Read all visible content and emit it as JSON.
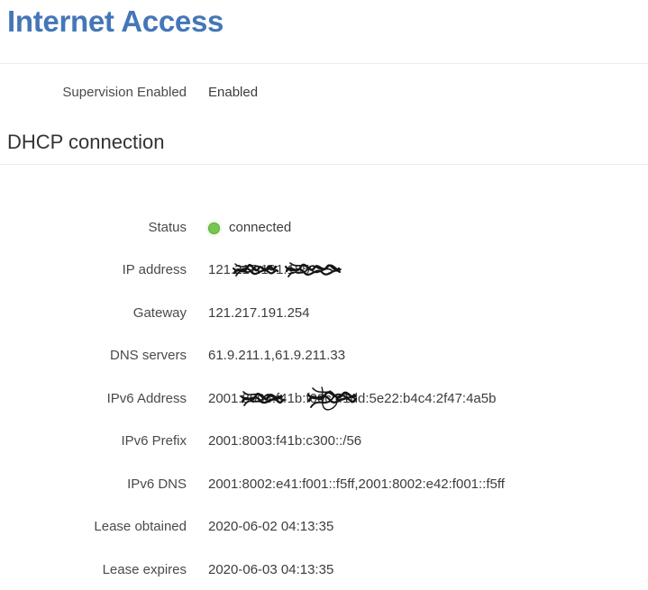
{
  "header": {
    "title": "Internet Access",
    "title_color": "#4477b8"
  },
  "supervision": {
    "label": "Supervision Enabled",
    "value": "Enabled"
  },
  "section": {
    "title": "DHCP connection"
  },
  "details": {
    "rows": [
      {
        "label": "Status",
        "value": "connected",
        "indicator": "status-dot-green",
        "indicator_color": "#79c553",
        "redacted": false
      },
      {
        "label": "IP address",
        "value": "121.217.191.185",
        "redacted": true
      },
      {
        "label": "Gateway",
        "value": "121.217.191.254",
        "redacted": false
      },
      {
        "label": "DNS servers",
        "value": "61.9.211.1,61.9.211.33",
        "redacted": false
      },
      {
        "label": "IPv6 Address",
        "value": "2001:8003:f41b:f00c:41dd:5e22:b4c4:2f47:4a5b",
        "redacted": true
      },
      {
        "label": "IPv6 Prefix",
        "value": "2001:8003:f41b:c300::/56",
        "redacted": false
      },
      {
        "label": "IPv6 DNS",
        "value": "2001:8002:e41:f001::f5ff,2001:8002:e42:f001::f5ff",
        "redacted": false
      },
      {
        "label": "Lease obtained",
        "value": "2020-06-02 04:13:35",
        "redacted": false
      },
      {
        "label": "Lease expires",
        "value": "2020-06-03 04:13:35",
        "redacted": false
      }
    ]
  }
}
